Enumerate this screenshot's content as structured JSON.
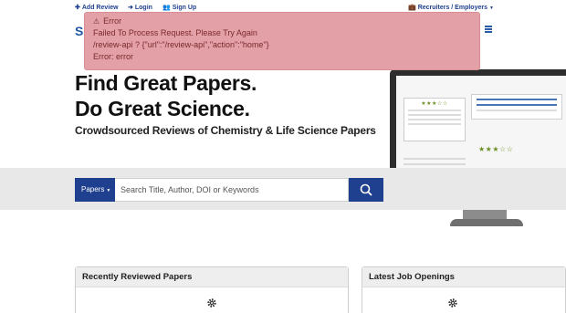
{
  "nav": {
    "add_review": "Add Review",
    "login": "Login",
    "signup": "Sign Up",
    "recruiters": "Recruiters / Employers"
  },
  "logo": {
    "text": "S"
  },
  "alert": {
    "title": "Error",
    "line1": "Failed To Process Request. Please Try Again",
    "line2": "/review-api ? {\"url\":\"/review-api\",\"action\":\"home\"}",
    "line3": "Error: error"
  },
  "hero": {
    "line1": "Find Great Papers.",
    "line2": "Do Great Science.",
    "tagline": "Crowdsourced Reviews of Chemistry & Life Science Papers"
  },
  "search": {
    "dropdown": "Papers",
    "placeholder": "Search Title, Author, DOI or Keywords"
  },
  "panels": {
    "recent": "Recently Reviewed Papers",
    "jobs": "Latest Job Openings"
  },
  "colors": {
    "brand_blue": "#1f3f8f",
    "alert_bg": "#e3a0a6",
    "band_gray": "#e8e8e8"
  }
}
